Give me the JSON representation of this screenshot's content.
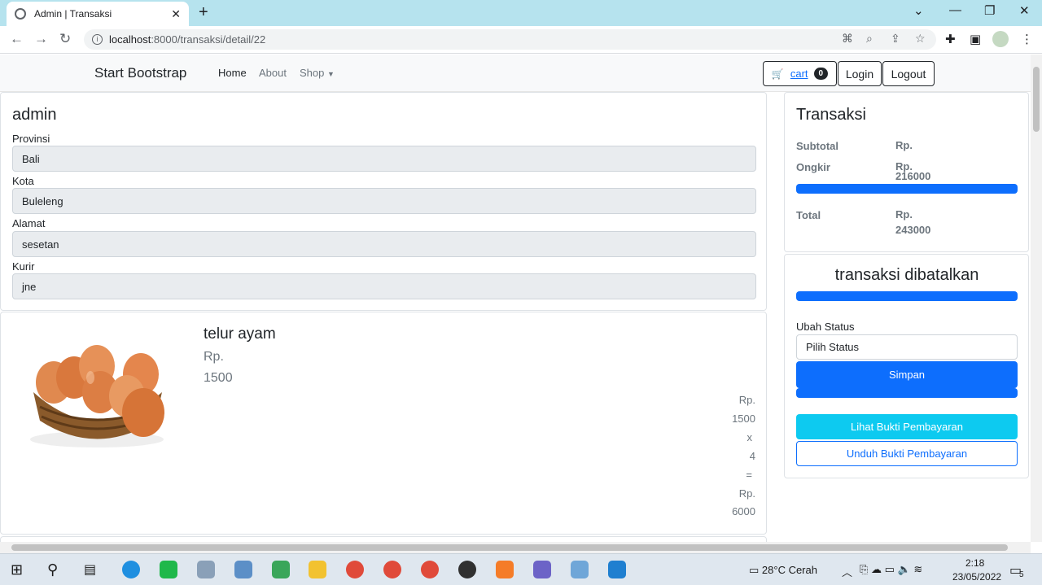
{
  "browser": {
    "tab_title": "Admin | Transaksi",
    "url_host": "localhost",
    "url_path": ":8000/transaksi/detail/22"
  },
  "navbar": {
    "brand": "Start Bootstrap",
    "links": [
      "Home",
      "About",
      "Shop"
    ],
    "cart_label": "cart",
    "cart_count": "0",
    "login": "Login",
    "logout": "Logout"
  },
  "customer": {
    "name": "admin",
    "fields": [
      {
        "label": "Provinsi",
        "value": "Bali"
      },
      {
        "label": "Kota",
        "value": "Buleleng"
      },
      {
        "label": "Alamat",
        "value": "sesetan"
      },
      {
        "label": "Kurir",
        "value": "jne"
      }
    ]
  },
  "product": {
    "name": "telur ayam",
    "price_prefix": "Rp.",
    "price": "1500",
    "calc": [
      "Rp.",
      "1500",
      "x",
      "4",
      "=",
      "Rp.",
      "6000"
    ]
  },
  "transaksi": {
    "title": "Transaksi",
    "subtotal_label": "Subtotal",
    "subtotal_prefix": "Rp.",
    "ongkir_label": "Ongkir",
    "ongkir_prefix": "Rp.",
    "ongkir_value": "216000",
    "total_label": "Total",
    "total_prefix": "Rp.",
    "total_value": "243000"
  },
  "status": {
    "title": "transaksi dibatalkan",
    "ubah_label": "Ubah Status",
    "select_placeholder": "Pilih Status",
    "save": "Simpan",
    "lihat": "Lihat Bukti Pembayaran",
    "unduh": "Unduh Bukti Pembayaran"
  },
  "taskbar": {
    "weather": "28°C  Cerah",
    "time": "2:18",
    "date": "23/05/2022",
    "notif_count": "5"
  }
}
